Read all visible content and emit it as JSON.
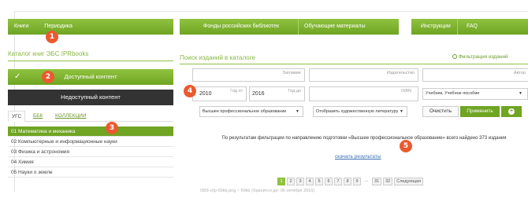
{
  "topnav": {
    "left_items": [
      "Книги",
      "Периодика"
    ],
    "right_items": [
      "Фонды российских библиотек",
      "Обучающие материалы",
      "Инструкции",
      "FAQ"
    ]
  },
  "sidebar": {
    "title": "Каталог книг ЭБС IPRbooks",
    "available_label": "Доступный контент",
    "unavailable_label": "Недоступный контент",
    "tabs": [
      "УГС",
      "ББК",
      "КОЛЛЕКЦИИ"
    ],
    "subjects": [
      "01 Математика и механика",
      "02 Компьютерные и информационные науки",
      "03 Физика и астрономия",
      "04 Химия",
      "05 Науки о земле"
    ]
  },
  "search": {
    "title": "Поиск изданий в каталоге",
    "filter_link": "Фильтрация изданий",
    "fields": {
      "title_label": "Заглавие",
      "publisher_label": "Издательство",
      "author_label": "Автор",
      "year_from_label": "Год от",
      "year_from_value": "2010",
      "year_to_label": "Год до",
      "year_to_value": "2016",
      "isbn_label": "ISBN",
      "type_value": "Учебник, Учебное пособие",
      "education_value": "Высшее профессиональное образование",
      "fiction_value": "Отобразить художественную литературу"
    },
    "clear_label": "Очистить",
    "apply_label": "Применить",
    "result_text": "По результатам фильтрации по направлению подготовки «Высшее профессиональное образование» всего найдено 373 издания",
    "download_link": "скачать результаты"
  },
  "pagination": {
    "pages": [
      "1",
      "2",
      "3",
      "4",
      "5",
      "6",
      "7",
      "8",
      "9",
      "...",
      "31",
      "32"
    ],
    "active": "1",
    "next_label": "Следующая"
  },
  "caption": "09f3-clip-69kb.png ~ 69kb (Хранится до: 06 октября 2016)",
  "markers": [
    "1",
    "2",
    "3",
    "4",
    "5"
  ],
  "colors": {
    "accent_green": "#6fa523",
    "marker_orange": "#ea5a2f",
    "dark_button": "#333333"
  }
}
